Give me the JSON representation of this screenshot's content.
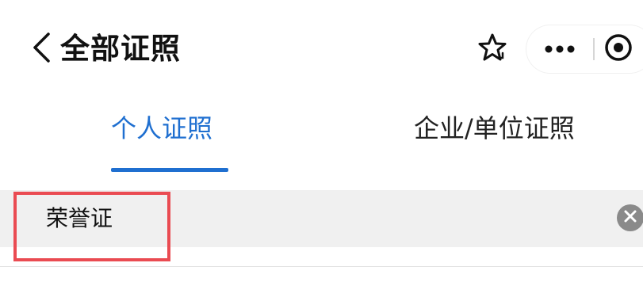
{
  "header": {
    "title": "全部证照",
    "icons": {
      "back": "chevron-left-icon",
      "favorite": "star-icon",
      "more": "more-dots-icon",
      "close": "target-circle-icon"
    }
  },
  "tabs": [
    {
      "label": "个人证照",
      "active": true
    },
    {
      "label": "企业/单位证照",
      "active": false
    }
  ],
  "search": {
    "value": "荣誉证",
    "clear_icon": "clear-circle-icon"
  },
  "colors": {
    "accent": "#1f6fd0",
    "highlight_border": "#ea4b52",
    "search_bg": "#f0f0f0"
  }
}
